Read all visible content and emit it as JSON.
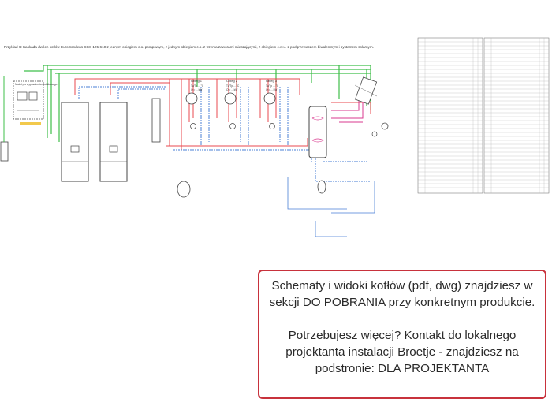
{
  "diagram": {
    "title": "Przykład 6: Kaskada dwóch kotłów EuroCondens SGS 125-610 z jednym obiegiem c.o. pompowym, z jednym obiegiem c.o. z trzema zaworami mieszającymi, z obiegiem c.w.u. z podgrzewaczem biwalentnym i systemem solarnym.",
    "left_module_label": "Moduł pro wyposażenia dodatkowego",
    "circuits": [
      {
        "name": "Obieg 1",
        "line1": "Tz/Tp ... °C",
        "line2": "Q = ... kW"
      },
      {
        "name": "Obieg 2",
        "line1": "Tz/Tp ... °C",
        "line2": "Q = ... kW"
      },
      {
        "name": "Obieg 3",
        "line1": "Tz/Tp ... °C",
        "line2": "Q = ... kW"
      }
    ],
    "colors": {
      "supply": "#e8484f",
      "return": "#4a7fd6",
      "gas": "#f2c94c",
      "control": "#3fbf4a",
      "solar": "#d93a8f",
      "equipment": "#444444"
    }
  },
  "caption": {
    "paragraph1": "Schematy i widoki kotłów (pdf, dwg) znajdziesz w sekcji DO POBRANIA przy konkretnym produkcie.",
    "paragraph2": "Potrzebujesz więcej? Kontakt do lokalnego projektanta instalacji Broetje -  znajdziesz na podstronie: DLA PROJEKTANTA"
  }
}
